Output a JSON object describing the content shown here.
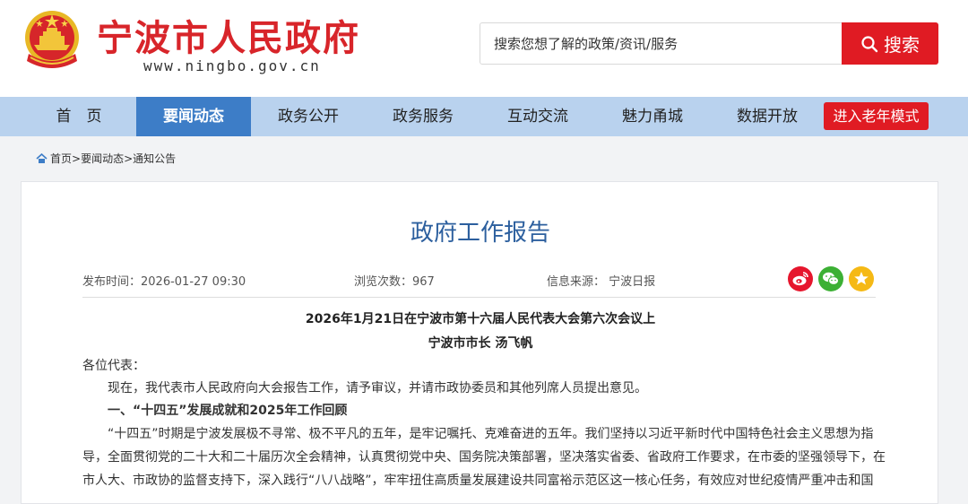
{
  "header": {
    "site_name": "宁波市人民政府",
    "site_url": "www.ningbo.gov.cn",
    "search_placeholder": "搜索您想了解的政策/资讯/服务",
    "search_button": "搜索"
  },
  "nav": {
    "items": [
      {
        "label": "首　页"
      },
      {
        "label": "要闻动态"
      },
      {
        "label": "政务公开"
      },
      {
        "label": "政务服务"
      },
      {
        "label": "互动交流"
      },
      {
        "label": "魅力甬城"
      },
      {
        "label": "数据开放"
      }
    ],
    "active_index": 1,
    "elder_mode": "进入老年模式"
  },
  "breadcrumb": {
    "home": "首页",
    "sep": ">",
    "section": "要闻动态",
    "current": "通知公告"
  },
  "article": {
    "title": "政府工作报告",
    "published": "发布时间：2026-01-27 09:30",
    "views": "浏览次数：967",
    "source": "信息来源：  宁波日报",
    "subhead_1": "2026年1月21日在宁波市第十六届人民代表大会第六次会议上",
    "subhead_2": "宁波市市长 汤飞帆",
    "salutation": "各位代表：",
    "para_1": "现在，我代表市人民政府向大会报告工作，请予审议，并请市政协委员和其他列席人员提出意见。",
    "section_1": "一、“十四五”发展成就和2025年工作回顾",
    "para_2_line_1": "“十四五”时期是宁波发展极不寻常、极不平凡的五年，是牢记嘱托、克难奋进的五年。我们坚持以习近平新时代中国特色社会主义思想为指",
    "para_2_line_2": "导，全面贯彻党的二十大和二十届历次全会精神，认真贯彻党中央、国务院决策部署，坚决落实省委、省政府工作要求，在市委的坚强领导下，在",
    "para_2_line_3": "市人大、市政协的监督支持下，深入践行“八八战略”，牢牢扭住高质量发展建设共同富裕示范区这一核心任务，有效应对世纪疫情严重冲击和国"
  },
  "share": {
    "icons": [
      "weibo-icon",
      "wechat-icon",
      "favorite-icon"
    ],
    "colors": {
      "weibo": "#e6162d",
      "wechat": "#3cb034",
      "favorite": "#f5b915"
    }
  },
  "colors": {
    "brand_red": "#e01b23",
    "nav_bg": "#b9d2ee",
    "nav_active": "#3d7dc7",
    "title_blue": "#2c5f9e"
  }
}
